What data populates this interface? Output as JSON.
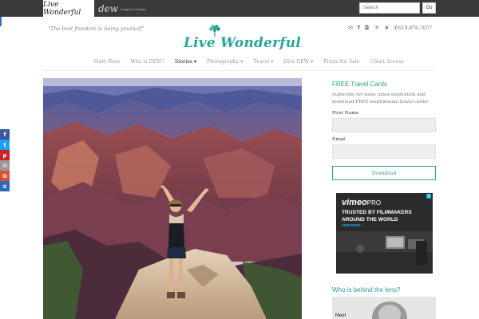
{
  "topbar": {
    "tab_live_wonderful": "Live Wonderful",
    "tab_dew_big": "dew",
    "tab_dew_small": "Imagery & Design",
    "search_placeholder": "Search",
    "go_label": "Go"
  },
  "header": {
    "tagline": "\"The best freedom is being yourself\"",
    "logo_text": "Live Wonderful",
    "phone": "619-876-7057",
    "social_icons": [
      "mail-icon",
      "facebook-icon",
      "instagram-icon",
      "pinterest-icon",
      "twitter-icon",
      "phone-icon"
    ]
  },
  "nav": {
    "items": [
      {
        "label": "Start Here"
      },
      {
        "label": "Who is DEW?"
      },
      {
        "label": "Stories ▾"
      },
      {
        "label": "Photography ▾"
      },
      {
        "label": "Travel ▾"
      },
      {
        "label": "Hire DEW ▾"
      },
      {
        "label": "Prints for Sale"
      },
      {
        "label": "Client Access"
      }
    ],
    "active_index": 2
  },
  "sidebar": {
    "title": "FREE Travel Cards",
    "description": "Subscribe for some inbox inspiration and download FREE inspirational travel cards!",
    "first_name_label": "First Name",
    "email_label": "Email",
    "download_label": "Download",
    "who_title": "Who is behind the lens?",
    "who_caption": "Meet"
  },
  "ad": {
    "brand": "vimeo",
    "brand_suffix": "PRO",
    "headline_1": "TRUSTED BY FILMMAKERS",
    "headline_2": "AROUND THE WORLD",
    "cta": "JOIN NOW ›",
    "close": "x"
  },
  "share_bar": {
    "buttons": [
      {
        "name": "share-facebook-icon",
        "glyph": "f",
        "color": "#3b5998"
      },
      {
        "name": "share-twitter-icon",
        "glyph": "t",
        "color": "#1da1f2"
      },
      {
        "name": "share-pinterest-icon",
        "glyph": "p",
        "color": "#cb2027"
      },
      {
        "name": "share-email-icon",
        "glyph": "✉",
        "color": "#999999"
      },
      {
        "name": "share-googleplus-icon",
        "glyph": "G",
        "color": "#dd4b39"
      },
      {
        "name": "share-more-icon",
        "glyph": "≋",
        "color": "#2c6ab5"
      }
    ]
  },
  "colors": {
    "brand_teal": "#2aa69a",
    "topbar": "#3a3a3a"
  }
}
